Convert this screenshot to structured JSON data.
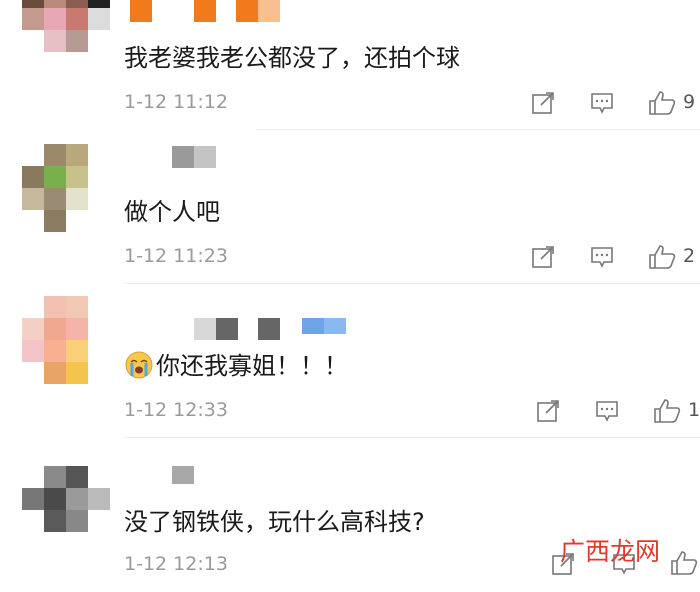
{
  "colors": {
    "text": "#1a1a1a",
    "meta": "#9a9a9a",
    "icon": "#777777",
    "watermark": "#e03a2e"
  },
  "comments": [
    {
      "text": "我老婆我老公都没了，还拍个球",
      "time": "1-12 11:12",
      "likes": "9"
    },
    {
      "text": "做个人吧",
      "time": "1-12 11:23",
      "likes": "2"
    },
    {
      "text": "你还我寡姐！！！",
      "emoji": "crying-face-icon",
      "time": "1-12 12:33",
      "likes": "1"
    },
    {
      "text": "没了钢铁侠，玩什么高科技?",
      "time": "1-12 12:13",
      "likes": ""
    }
  ],
  "watermark": "广西龙网"
}
